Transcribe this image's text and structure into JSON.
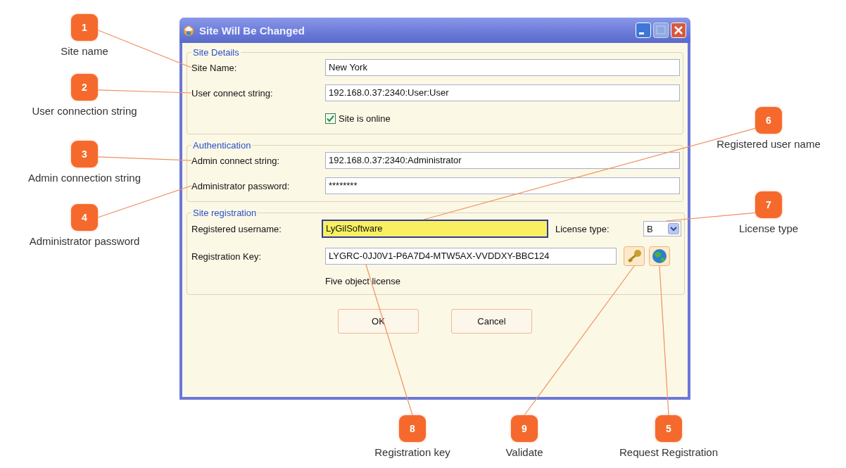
{
  "window": {
    "title": "Site Will Be Changed"
  },
  "groups": [
    {
      "title": "Site Details",
      "rows": [
        {
          "kind": "field",
          "label": "Site Name:",
          "value": "New York"
        },
        {
          "kind": "field",
          "label": "User connect string:",
          "value": "192.168.0.37:2340:User:User"
        },
        {
          "kind": "checkbox",
          "label": "Site is online",
          "checked": true
        }
      ]
    },
    {
      "title": "Authentication",
      "rows": [
        {
          "kind": "field",
          "label": "Admin connect string:",
          "value": "192.168.0.37:2340:Administrator"
        },
        {
          "kind": "field",
          "label": "Administrator password:",
          "value": "********"
        }
      ]
    },
    {
      "title": "Site registration",
      "rows": [
        {
          "kind": "field_combo",
          "label": "Registered username:",
          "value": "LyGilSoftware",
          "focused": true,
          "combo_label": "License type:",
          "combo_value": "B"
        },
        {
          "kind": "field_buttons",
          "label": "Registration Key:",
          "value": "LYGRC-0JJ0V1-P6A7D4-MTW5AX-VVDDXY-BBC124"
        },
        {
          "kind": "note",
          "label": "Five object license"
        }
      ]
    }
  ],
  "buttons": [
    "OK",
    "Cancel"
  ],
  "callouts": [
    {
      "number": "1",
      "label": "Site name"
    },
    {
      "number": "2",
      "label": "User connection string"
    },
    {
      "number": "3",
      "label": "Admin connection string"
    },
    {
      "number": "4",
      "label": "Administrator password"
    },
    {
      "number": "6",
      "label": "Registered user name"
    },
    {
      "number": "7",
      "label": "License type"
    },
    {
      "number": "8",
      "label": "Registration key"
    },
    {
      "number": "9",
      "label": "Validate"
    },
    {
      "number": "5",
      "label": "Request Registration"
    }
  ]
}
